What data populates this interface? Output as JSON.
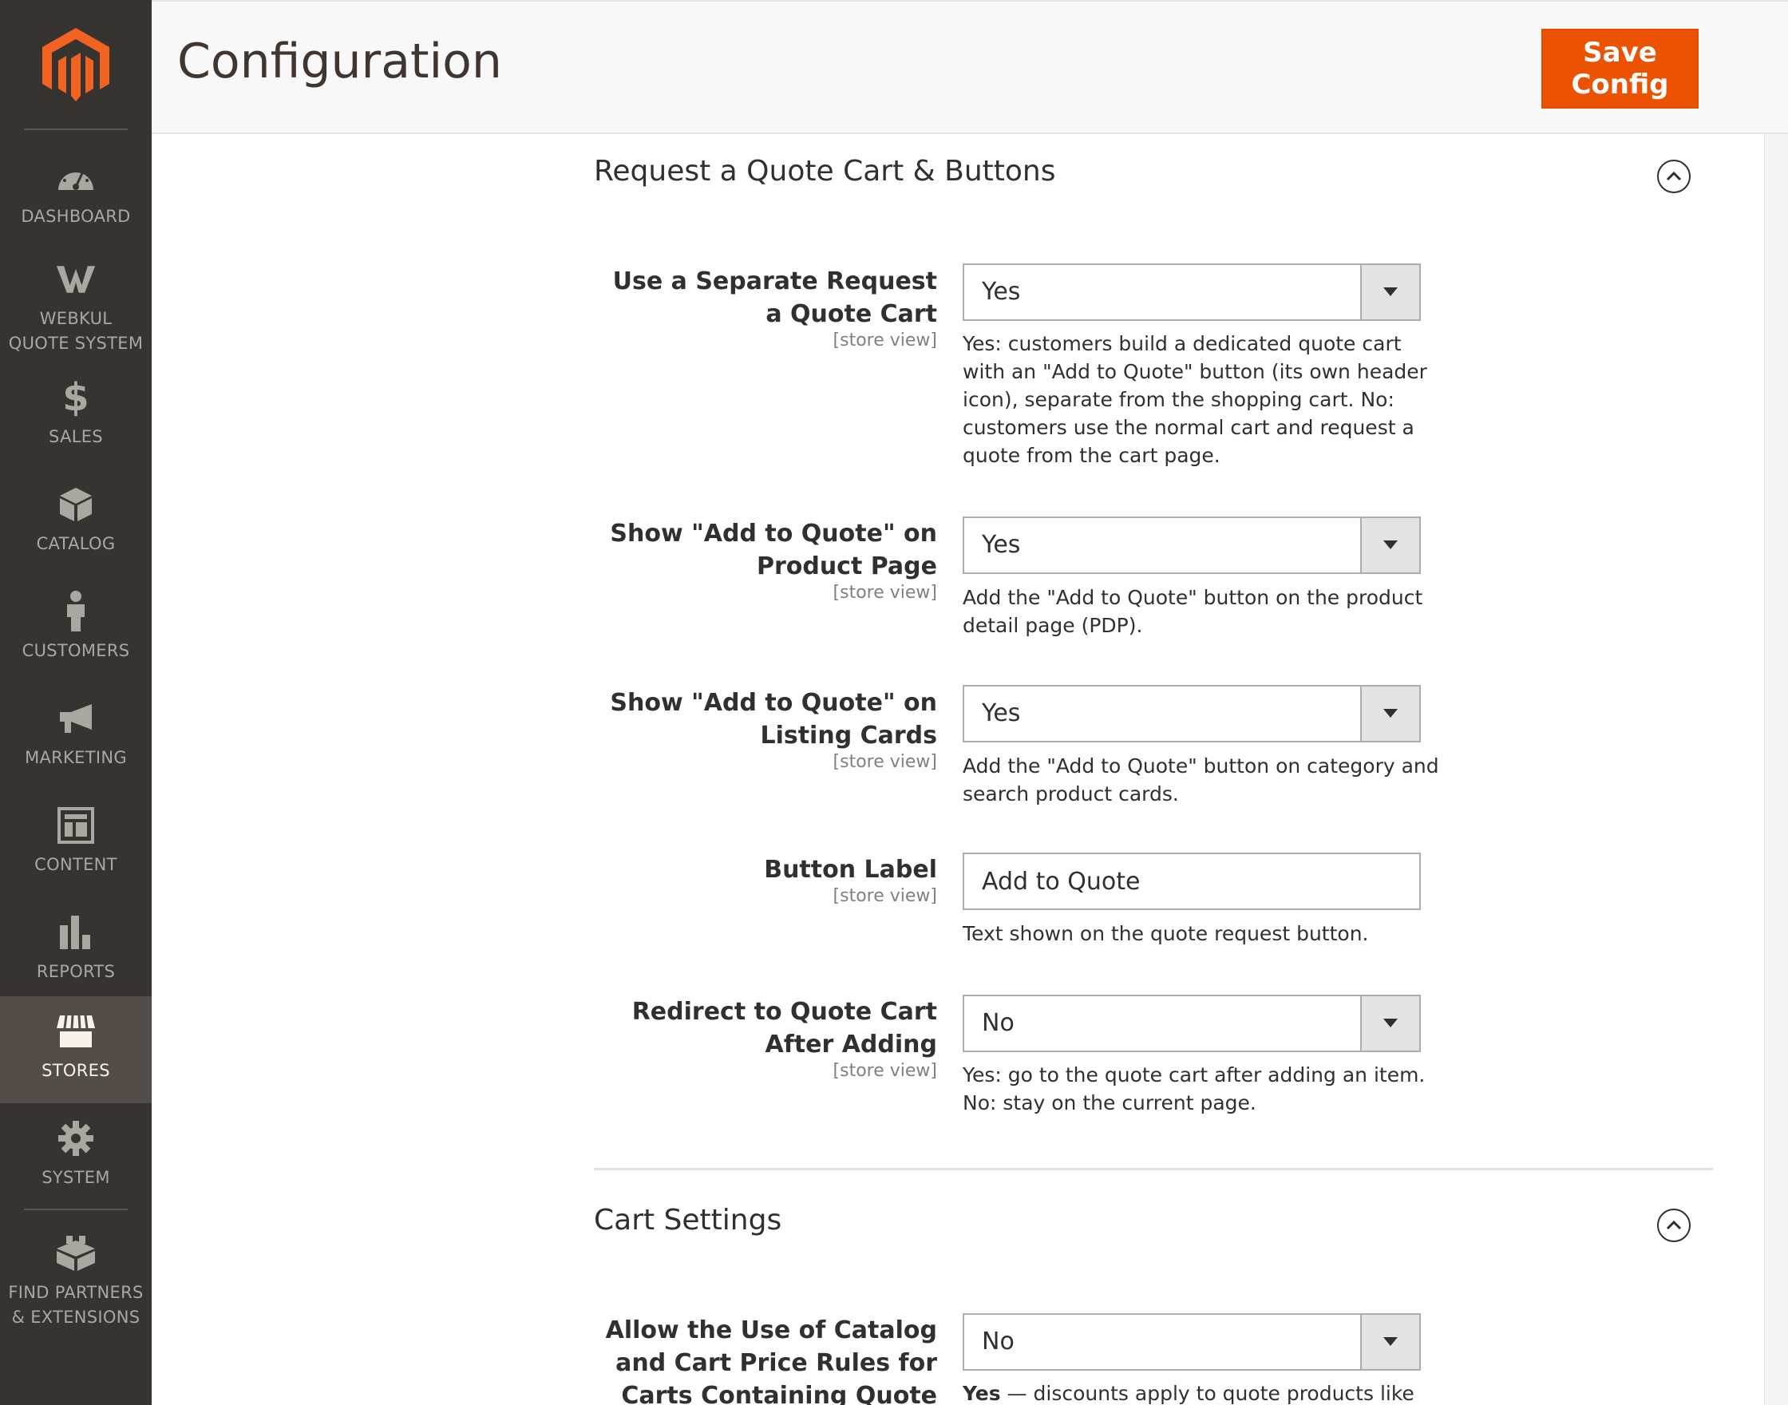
{
  "sidebar": {
    "items": [
      {
        "label": "DASHBOARD",
        "icon": "dashboard-icon"
      },
      {
        "label": "WEBKUL\nQUOTE SYSTEM",
        "icon": "webkul-icon"
      },
      {
        "label": "SALES",
        "icon": "dollar-icon"
      },
      {
        "label": "CATALOG",
        "icon": "box-icon"
      },
      {
        "label": "CUSTOMERS",
        "icon": "person-icon"
      },
      {
        "label": "MARKETING",
        "icon": "megaphone-icon"
      },
      {
        "label": "CONTENT",
        "icon": "layout-icon"
      },
      {
        "label": "REPORTS",
        "icon": "bar-chart-icon"
      },
      {
        "label": "STORES",
        "icon": "store-icon"
      },
      {
        "label": "SYSTEM",
        "icon": "gear-icon"
      },
      {
        "label": "FIND PARTNERS\n& EXTENSIONS",
        "icon": "blocks-icon"
      }
    ],
    "active": "STORES"
  },
  "header": {
    "title": "Configuration",
    "save_label": "Save Config"
  },
  "sections": [
    {
      "title": "Request a Quote Cart & Buttons",
      "fields": [
        {
          "label": "Use a Separate Request a Quote Cart",
          "scope": "[store view]",
          "value": "Yes",
          "note": "Yes: customers build a dedicated quote cart with an \"Add to Quote\" button (its own header icon), separate from the shopping cart. No: customers use the normal cart and request a quote from the cart page."
        },
        {
          "label": "Show \"Add to Quote\" on Product Page",
          "scope": "[store view]",
          "value": "Yes",
          "note": "Add the \"Add to Quote\" button on the product detail page (PDP)."
        },
        {
          "label": "Show \"Add to Quote\" on Listing Cards",
          "scope": "[store view]",
          "value": "Yes",
          "note": "Add the \"Add to Quote\" button on category and search product cards."
        },
        {
          "label": "Button Label",
          "scope": "[store view]",
          "value": "Add to Quote",
          "note": "Text shown on the quote request button."
        },
        {
          "label": "Redirect to Quote Cart After Adding",
          "scope": "[store view]",
          "value": "No",
          "note": "Yes: go to the quote cart after adding an item. No: stay on the current page."
        }
      ]
    },
    {
      "title": "Cart Settings",
      "fields": [
        {
          "label": "Allow the Use of Catalog and Cart Price Rules for Carts Containing Quote Products",
          "value": "No",
          "note_bold": "Yes",
          "note": " — discounts apply to quote products like"
        }
      ]
    }
  ],
  "colors": {
    "accent": "#eb5202",
    "sidebar": "#373330",
    "active": "#524d49"
  }
}
